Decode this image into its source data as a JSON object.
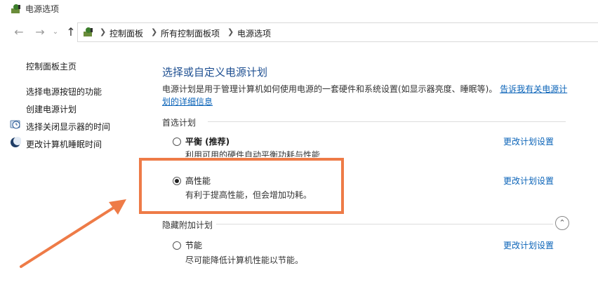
{
  "window": {
    "title": "电源选项"
  },
  "address": {
    "crumbs": [
      "控制面板",
      "所有控制面板项",
      "电源选项"
    ]
  },
  "sidebar": {
    "home": "控制面板主页",
    "items": [
      {
        "label": "选择电源按钮的功能"
      },
      {
        "label": "创建电源计划"
      },
      {
        "label": "选择关闭显示器的时间"
      },
      {
        "label": "更改计算机睡眠时间"
      }
    ]
  },
  "main": {
    "heading": "选择或自定义电源计划",
    "description": "电源计划是用于管理计算机如何使用电源的一套硬件和系统设置(如显示器亮度、睡眠等)。",
    "description_link": "告诉我有关电源计划的详细信息",
    "preferred_label": "首选计划",
    "hidden_label": "隐藏附加计划",
    "change_label": "更改计划设置",
    "plans": [
      {
        "name": "平衡 (推荐)",
        "desc": "利用可用的硬件自动平衡功耗与性能",
        "selected": false
      },
      {
        "name": "高性能",
        "desc": "有利于提高性能，但会增加功耗。",
        "selected": true
      },
      {
        "name": "节能",
        "desc": "尽可能降低计算机性能以节能。",
        "selected": false
      }
    ]
  },
  "annotation": {
    "color": "#ee7b47"
  }
}
